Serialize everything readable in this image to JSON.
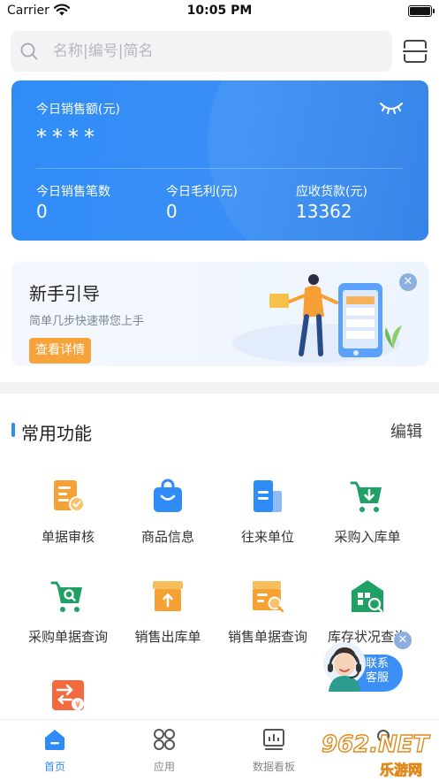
{
  "status_bar": {
    "carrier": "Carrier",
    "time": "10:05 PM"
  },
  "search": {
    "placeholder": "名称|编号|简名"
  },
  "sales_card": {
    "today_sales_label": "今日销售额(元)",
    "today_sales_value": "****",
    "today_count_label": "今日销售笔数",
    "today_count_value": "0",
    "today_profit_label": "今日毛利(元)",
    "today_profit_value": "0",
    "receivable_label": "应收货款(元)",
    "receivable_value": "13362"
  },
  "guide": {
    "title": "新手引导",
    "subtitle": "简单几步快速带您上手",
    "button": "查看详情"
  },
  "common": {
    "title": "常用功能",
    "edit": "编辑",
    "items": [
      {
        "label": "单据审核",
        "icon": "document-check-icon"
      },
      {
        "label": "商品信息",
        "icon": "shopping-bag-icon"
      },
      {
        "label": "往来单位",
        "icon": "building-icon"
      },
      {
        "label": "采购入库单",
        "icon": "cart-in-icon"
      },
      {
        "label": "采购单据查询",
        "icon": "cart-search-icon"
      },
      {
        "label": "销售出库单",
        "icon": "box-out-icon"
      },
      {
        "label": "销售单据查询",
        "icon": "receipt-search-icon"
      },
      {
        "label": "库存状况查询",
        "icon": "warehouse-search-icon"
      },
      {
        "label": "",
        "icon": "exchange-yuan-icon"
      }
    ]
  },
  "customer_service": {
    "line1": "联系",
    "line2": "客服"
  },
  "tabbar": {
    "items": [
      {
        "label": "首页",
        "icon": "home-icon"
      },
      {
        "label": "应用",
        "icon": "apps-icon"
      },
      {
        "label": "数据看板",
        "icon": "dashboard-icon"
      },
      {
        "label": "",
        "icon": "profile-icon"
      }
    ]
  },
  "watermark": {
    "top": "962.NET",
    "bottom": "乐游网"
  },
  "colors": {
    "primary": "#2f8cf7",
    "accent": "#f7a33c",
    "green": "#1fa065"
  }
}
